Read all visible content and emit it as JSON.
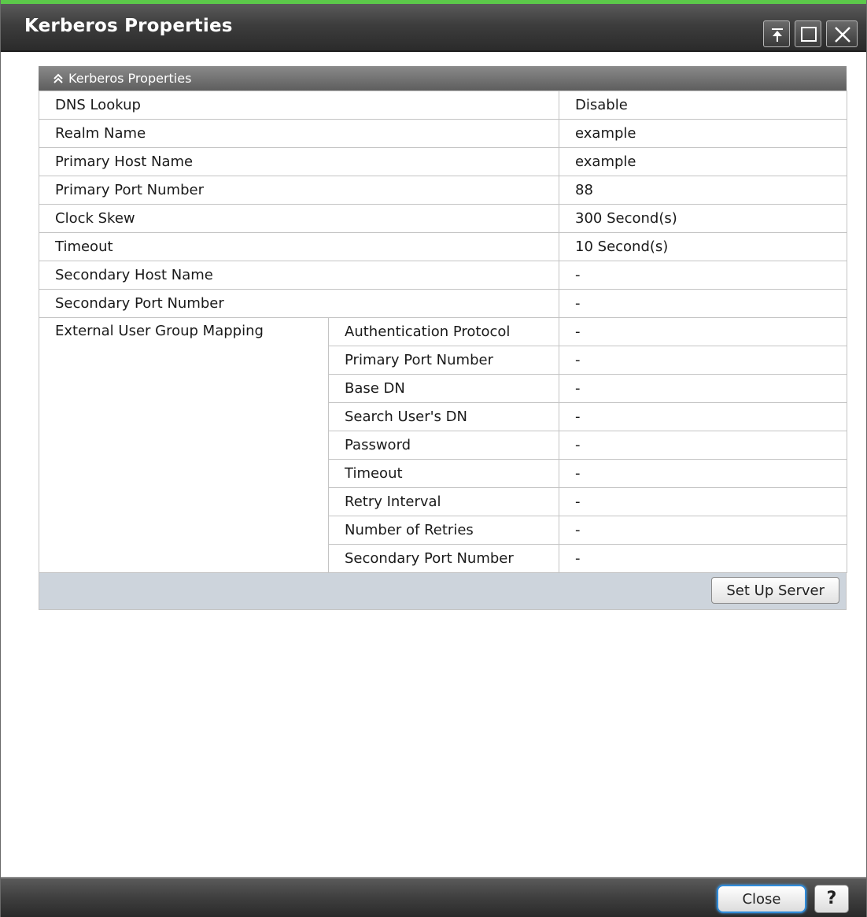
{
  "window": {
    "title": "Kerberos Properties"
  },
  "panel": {
    "header": "Kerberos Properties",
    "rows": [
      {
        "label": "DNS Lookup",
        "value": "Disable"
      },
      {
        "label": "Realm Name",
        "value": "example"
      },
      {
        "label": "Primary Host Name",
        "value": "example"
      },
      {
        "label": "Primary Port Number",
        "value": "88"
      },
      {
        "label": "Clock Skew",
        "value": "300 Second(s)"
      },
      {
        "label": "Timeout",
        "value": "10 Second(s)"
      },
      {
        "label": "Secondary Host Name",
        "value": "-"
      },
      {
        "label": "Secondary Port Number",
        "value": "-"
      }
    ],
    "group": {
      "label": "External User Group Mapping",
      "rows": [
        {
          "label": "Authentication Protocol",
          "value": "-"
        },
        {
          "label": "Primary Port Number",
          "value": "-"
        },
        {
          "label": "Base DN",
          "value": "-"
        },
        {
          "label": "Search User's DN",
          "value": "-"
        },
        {
          "label": "Password",
          "value": "-"
        },
        {
          "label": "Timeout",
          "value": "-"
        },
        {
          "label": "Retry Interval",
          "value": "-"
        },
        {
          "label": "Number of Retries",
          "value": "-"
        },
        {
          "label": "Secondary Port Number",
          "value": "-"
        }
      ]
    },
    "setup_button": "Set Up Server"
  },
  "footer": {
    "close_label": "Close",
    "help_label": "?"
  },
  "icons": {
    "pin": "pin-top-icon",
    "maximize": "maximize-icon",
    "close": "close-icon",
    "collapse": "collapse-chevron-icon"
  },
  "colors": {
    "accent_green": "#5cc94a",
    "close_focus": "#2f8ad8",
    "footer_band": "#cdd4dc"
  }
}
